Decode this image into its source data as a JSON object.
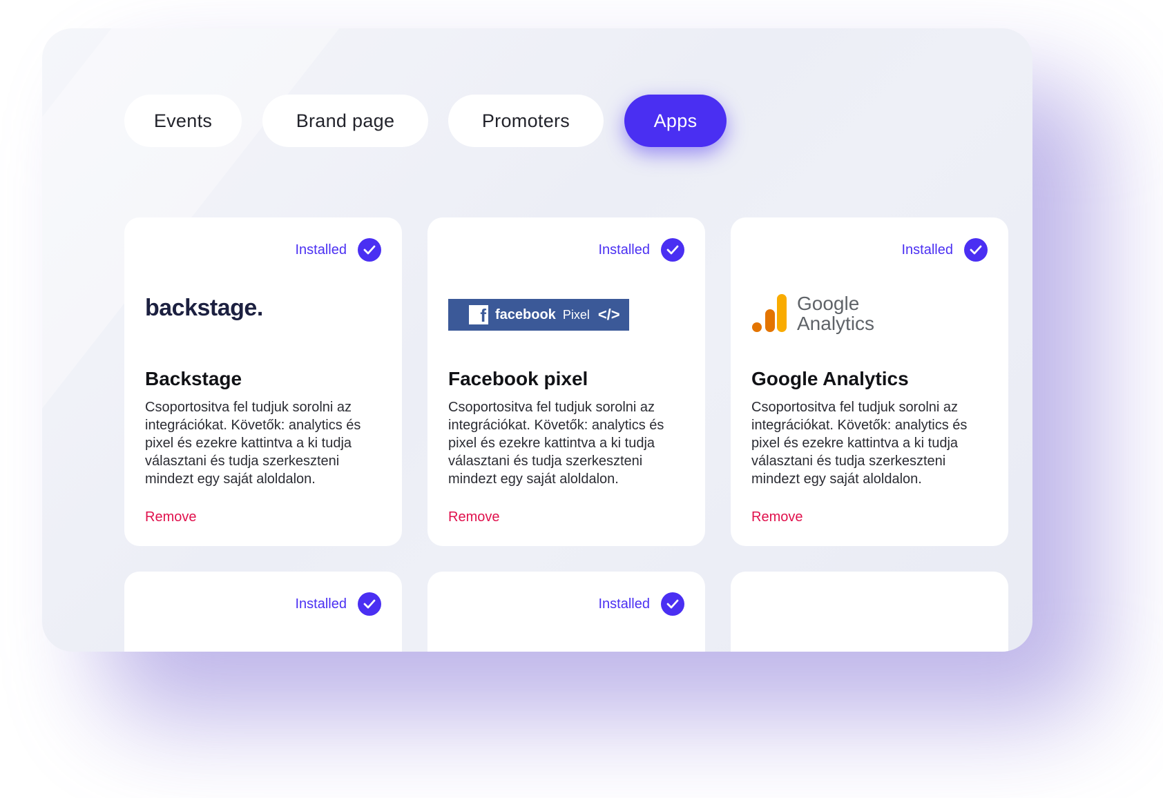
{
  "tabs": [
    {
      "label": "Events",
      "active": false
    },
    {
      "label": "Brand page",
      "active": false
    },
    {
      "label": "Promoters",
      "active": false
    },
    {
      "label": "Apps",
      "active": true
    }
  ],
  "colors": {
    "accent": "#4a2ff2",
    "remove": "#e0104c",
    "facebook_blue": "#3b5998",
    "ga_orange_dark": "#e37400",
    "ga_orange_light": "#f9ab00"
  },
  "apps": [
    {
      "status": "Installed",
      "logo": {
        "icon": "backstage-logo",
        "text": "backstage."
      },
      "title": "Backstage",
      "description": "Csoportositva fel tudjuk sorolni az integrációkat. Követők: analytics és pixel és ezekre kattintva a ki tudja választani és tudja szerkeszteni mindezt egy saját aloldalon.",
      "remove_label": "Remove"
    },
    {
      "status": "Installed",
      "logo": {
        "icon": "facebook-pixel-logo",
        "brand": "facebook",
        "product": "Pixel",
        "code_glyph": "</>"
      },
      "title": "Facebook pixel",
      "description": "Csoportositva fel tudjuk sorolni az integrációkat. Követők: analytics és pixel és ezekre kattintva a ki tudja választani és tudja szerkeszteni mindezt egy saját aloldalon.",
      "remove_label": "Remove"
    },
    {
      "status": "Installed",
      "logo": {
        "icon": "google-analytics-logo",
        "line1": "Google",
        "line2": "Analytics"
      },
      "title": "Google Analytics",
      "description": "Csoportositva fel tudjuk sorolni az integrációkat. Követők: analytics és pixel és ezekre kattintva a ki tudja választani és tudja szerkeszteni mindezt egy saját aloldalon.",
      "remove_label": "Remove"
    },
    {
      "status": "Installed"
    },
    {
      "status": "Installed"
    },
    {
      "status": ""
    }
  ]
}
